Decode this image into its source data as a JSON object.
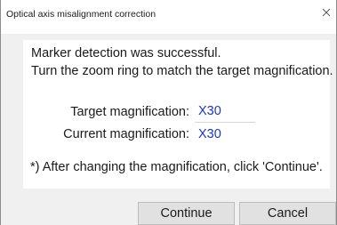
{
  "window": {
    "title": "Optical axis misalignment correction",
    "close_icon": "close-icon"
  },
  "message": {
    "line1": "Marker detection was successful.",
    "line2": "Turn the zoom ring to match the target magnification."
  },
  "target": {
    "label": "Target magnification:",
    "value": "X30"
  },
  "current": {
    "label": "Current magnification:",
    "value": "X30"
  },
  "note": "*) After changing the magnification, click 'Continue'.",
  "buttons": {
    "continue_label": "Continue",
    "cancel_label": "Cancel"
  },
  "colors": {
    "value_text": "#1a33cc",
    "panel_bg": "#ffffff",
    "dialog_bg": "#f0f0f0"
  }
}
